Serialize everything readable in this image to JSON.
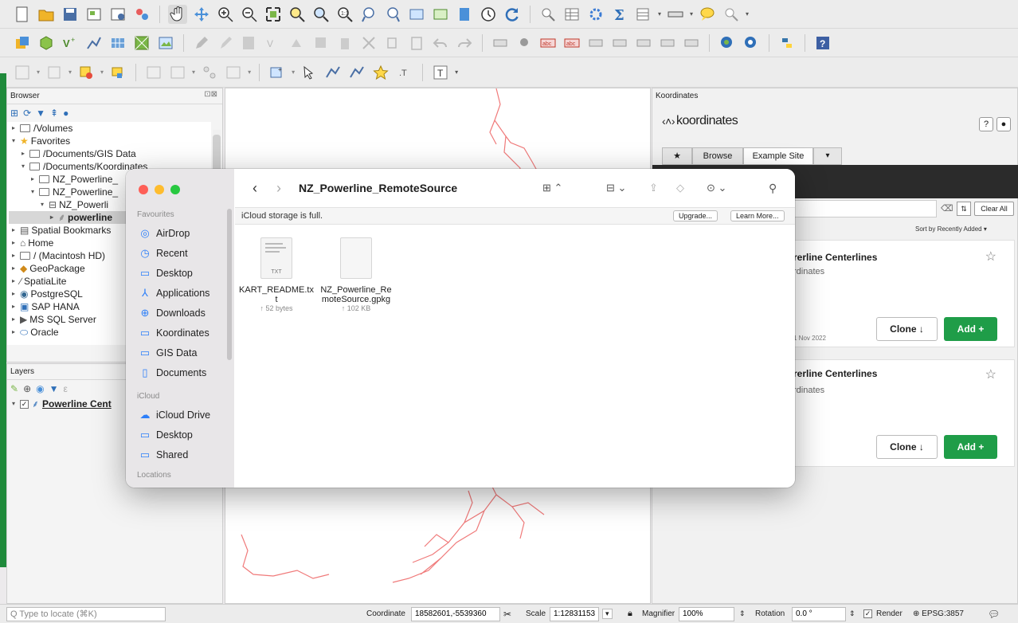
{
  "browser_panel": {
    "title": "Browser",
    "tree": [
      {
        "label": "/Volumes",
        "level": 0,
        "expanded": false
      },
      {
        "label": "Favorites",
        "level": 0,
        "expanded": true
      },
      {
        "label": "/Documents/GIS Data",
        "level": 1,
        "expanded": false
      },
      {
        "label": "/Documents/Koordinates",
        "level": 1,
        "expanded": true
      },
      {
        "label": "NZ_Powerline_",
        "level": 2,
        "expanded": false
      },
      {
        "label": "NZ_Powerline_",
        "level": 2,
        "expanded": true
      },
      {
        "label": "NZ_Powerli",
        "level": 3,
        "expanded": true
      },
      {
        "label": "powerline",
        "level": 4,
        "expanded": false
      },
      {
        "label": "Spatial Bookmarks",
        "level": 0,
        "expanded": false
      },
      {
        "label": "Home",
        "level": 0,
        "expanded": false
      },
      {
        "label": "/ (Macintosh HD)",
        "level": 0,
        "expanded": false
      },
      {
        "label": "GeoPackage",
        "level": 0,
        "expanded": false
      },
      {
        "label": "SpatiaLite",
        "level": 0,
        "expanded": false
      },
      {
        "label": "PostgreSQL",
        "level": 0,
        "expanded": false
      },
      {
        "label": "SAP HANA",
        "level": 0,
        "expanded": false
      },
      {
        "label": "MS SQL Server",
        "level": 0,
        "expanded": false
      },
      {
        "label": "Oracle",
        "level": 0,
        "expanded": false
      }
    ]
  },
  "layers_panel": {
    "title": "Layers",
    "layer_name": "Powerline Cent"
  },
  "koordinates_panel": {
    "title": "Koordinates",
    "logo_text": "koordinates",
    "tabs": [
      "★",
      "Browse",
      "Example Site"
    ],
    "clear_all": "Clear All",
    "sort_label": "Sort by Recently Added",
    "cards": [
      {
        "title": "rerline Centerlines",
        "publisher": "rdinates",
        "date": "1 Nov 2022",
        "clone_label": "Clone",
        "add_label": "Add"
      },
      {
        "title": "rerline Centerlines",
        "publisher": "rdinates",
        "date": "",
        "clone_label": "Clone",
        "add_label": "Add"
      }
    ]
  },
  "finder": {
    "folder_title": "NZ_Powerline_RemoteSource",
    "banner_text": "iCloud storage is full.",
    "upgrade_label": "Upgrade...",
    "learn_more_label": "Learn More...",
    "sidebar": {
      "favourites_heading": "Favourites",
      "favourites": [
        {
          "label": "AirDrop",
          "icon": "airdrop-icon"
        },
        {
          "label": "Recent",
          "icon": "clock-icon"
        },
        {
          "label": "Desktop",
          "icon": "desktop-icon"
        },
        {
          "label": "Applications",
          "icon": "applications-icon"
        },
        {
          "label": "Downloads",
          "icon": "download-icon"
        },
        {
          "label": "Koordinates",
          "icon": "folder-icon"
        },
        {
          "label": "GIS Data",
          "icon": "folder-icon"
        },
        {
          "label": "Documents",
          "icon": "document-icon"
        }
      ],
      "icloud_heading": "iCloud",
      "icloud": [
        {
          "label": "iCloud Drive",
          "icon": "cloud-icon"
        },
        {
          "label": "Desktop",
          "icon": "desktop-icon"
        },
        {
          "label": "Shared",
          "icon": "shared-folder-icon"
        }
      ],
      "locations_heading": "Locations"
    },
    "files": [
      {
        "name_line1": "KART_README.tx",
        "name_line2": "t",
        "size": "↑ 52 bytes",
        "badge": "TXT"
      },
      {
        "name_line1": "NZ_Powerline_Re",
        "name_line2": "moteSource.gpkg",
        "size": "↑ 102 KB",
        "badge": ""
      }
    ]
  },
  "status_bar": {
    "locate_placeholder": "Q Type to locate (⌘K)",
    "coordinate_label": "Coordinate",
    "coordinate_value": "18582601,-5539360",
    "scale_label": "Scale",
    "scale_value": "1:12831153",
    "magnifier_label": "Magnifier",
    "magnifier_value": "100%",
    "rotation_label": "Rotation",
    "rotation_value": "0.0 °",
    "render_label": "Render",
    "crs_label": "EPSG:3857"
  },
  "colors": {
    "powerline": "#f07a7a",
    "add_green": "#1f9d48",
    "finder_close": "#fe5f57",
    "finder_min": "#febc2e",
    "finder_max": "#28c840"
  }
}
